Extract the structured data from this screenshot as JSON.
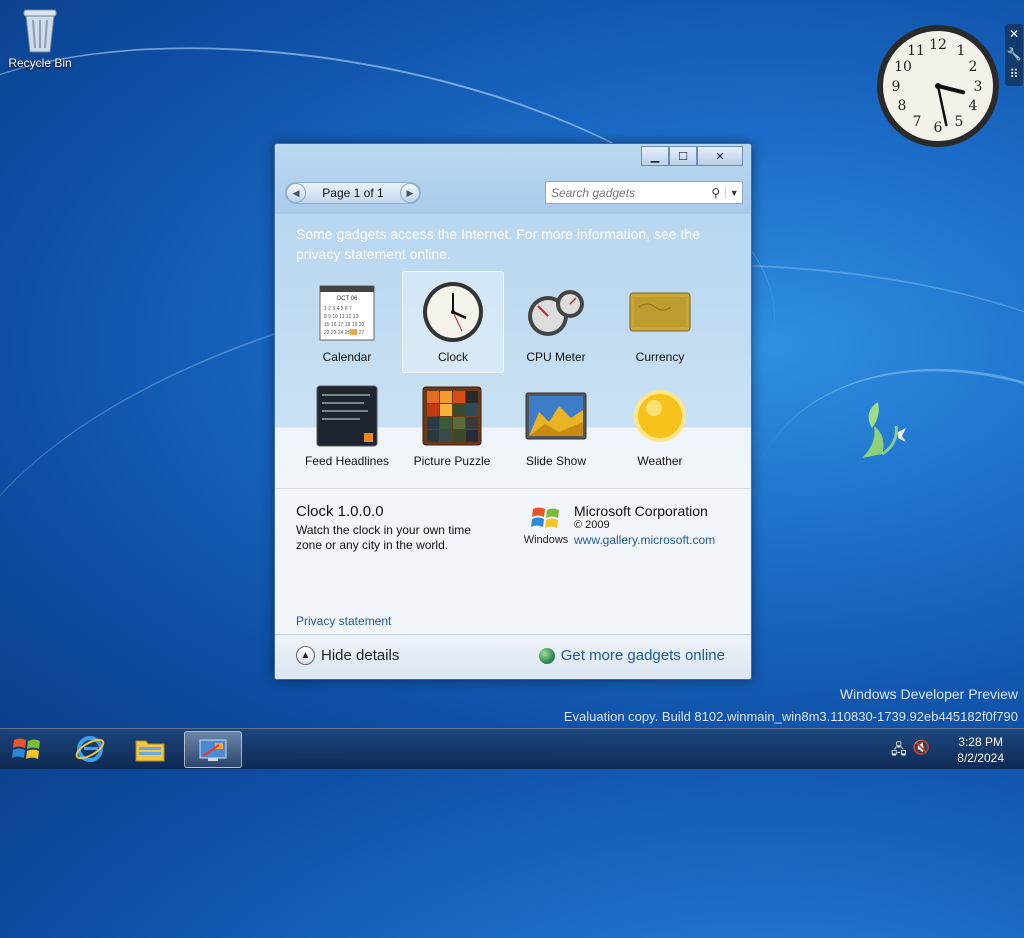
{
  "desktop": {
    "recycle_bin_label": "Recycle Bin",
    "watermark_line1": "Windows Developer Preview",
    "watermark_line2": "Evaluation copy. Build 8102.winmain_win8m3.110830-1739.92eb445182f0f790"
  },
  "clock_gadget": {
    "hour": 3,
    "minute": 28
  },
  "window": {
    "pager_label": "Page 1 of 1",
    "search_placeholder": "Search gadgets",
    "notice": "Some gadgets access the Internet.  For more information, see the privacy statement online.",
    "gadgets": [
      {
        "label": "Calendar",
        "icon": "calendar-icon"
      },
      {
        "label": "Clock",
        "icon": "clock-icon",
        "selected": true
      },
      {
        "label": "CPU Meter",
        "icon": "cpu-meter-icon"
      },
      {
        "label": "Currency",
        "icon": "currency-icon"
      },
      {
        "label": "Feed Headlines",
        "icon": "feed-headlines-icon"
      },
      {
        "label": "Picture Puzzle",
        "icon": "picture-puzzle-icon"
      },
      {
        "label": "Slide Show",
        "icon": "slide-show-icon"
      },
      {
        "label": "Weather",
        "icon": "weather-icon"
      }
    ],
    "calendar_month": "OCT 06",
    "details": {
      "title": "Clock 1.0.0.0",
      "description": "Watch the clock in your own time zone or any city in the world.",
      "windows_label": "Windows",
      "publisher": "Microsoft Corporation",
      "copyright": "© 2009",
      "link": "www.gallery.microsoft.com",
      "privacy": "Privacy statement"
    },
    "footer": {
      "hide_details": "Hide details",
      "get_more": "Get more gadgets online"
    }
  },
  "taskbar": {
    "time": "3:28 PM",
    "date": "8/2/2024"
  }
}
